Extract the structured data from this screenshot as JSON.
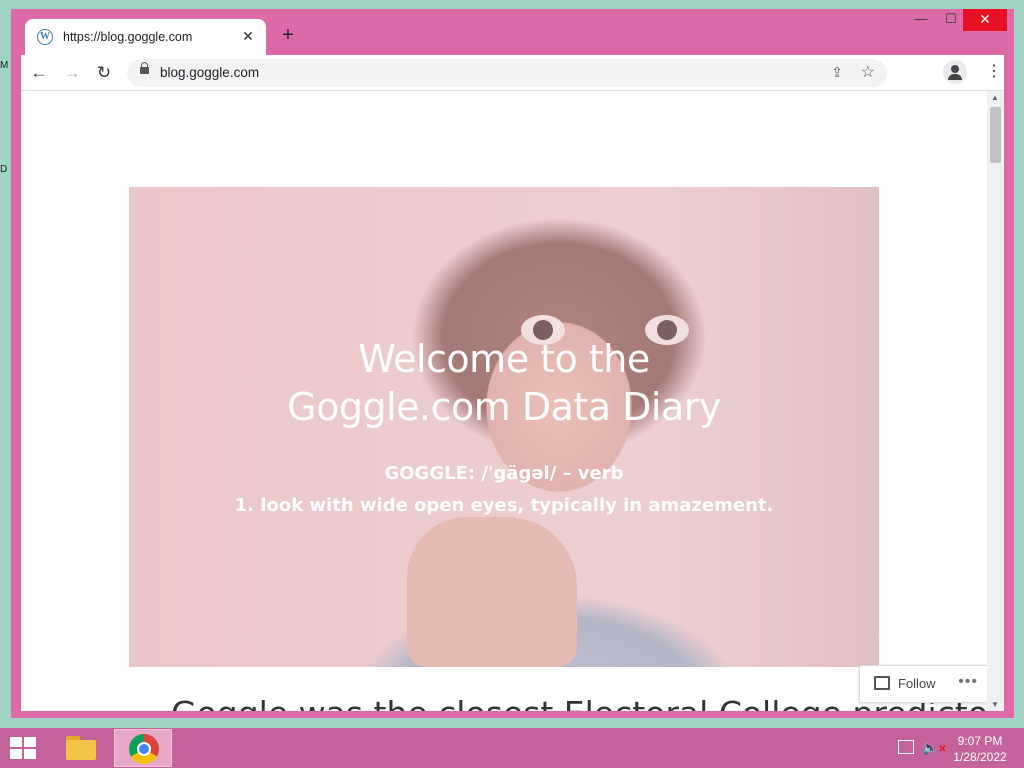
{
  "desktop": {
    "edge_letters": [
      "M",
      "D"
    ]
  },
  "browser": {
    "tab": {
      "favicon": "wordpress-icon",
      "title": "https://blog.goggle.com",
      "close": "✕"
    },
    "new_tab_label": "+",
    "window_controls": {
      "minimize": "—",
      "maximize": "☐",
      "close": "✕"
    },
    "nav": {
      "back": "←",
      "forward": "→",
      "reload": "↻"
    },
    "address": {
      "url": "blog.goggle.com"
    },
    "icons": {
      "share": "⇪",
      "bookmark": "☆",
      "menu": "⋮"
    }
  },
  "page": {
    "hero": {
      "title_line1": "Welcome to the",
      "title_line2": "Goggle.com Data Diary",
      "definition_line1": "GOGGLE: /ˈgägəl/ – verb",
      "definition_line2": "1. look with wide open eyes, typically in amazement."
    },
    "post_headline": "Goggle was the closest Electoral College predictor",
    "follow": {
      "label": "Follow",
      "more": "•••"
    }
  },
  "taskbar": {
    "time": "9:07 PM",
    "date": "1/28/2022",
    "volume_icon": "🔈",
    "volume_muted": "✕"
  }
}
